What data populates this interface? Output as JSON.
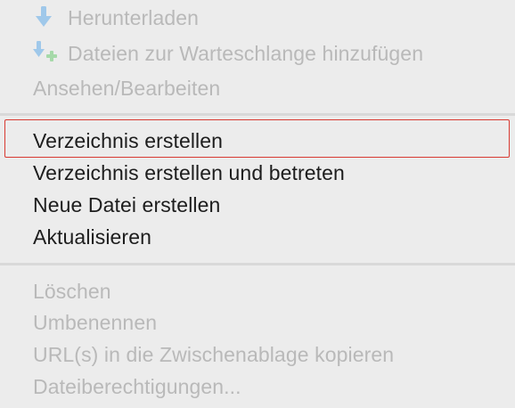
{
  "context_menu": {
    "items_top": [
      {
        "label": "Herunterladen",
        "icon": "download-arrow-icon",
        "enabled": false
      },
      {
        "label": "Dateien zur Warteschlange hinzufügen",
        "icon": "add-to-queue-icon",
        "enabled": false
      },
      {
        "label": "Ansehen/Bearbeiten",
        "enabled": false
      }
    ],
    "items_middle": [
      {
        "label": "Verzeichnis erstellen",
        "enabled": true,
        "highlighted": true
      },
      {
        "label": "Verzeichnis erstellen und betreten",
        "enabled": true
      },
      {
        "label": "Neue Datei erstellen",
        "enabled": true
      },
      {
        "label": "Aktualisieren",
        "enabled": true
      }
    ],
    "items_bottom": [
      {
        "label": "Löschen",
        "enabled": false
      },
      {
        "label": "Umbenennen",
        "enabled": false
      },
      {
        "label": "URL(s) in die Zwischenablage kopieren",
        "enabled": false
      },
      {
        "label": "Dateiberechtigungen...",
        "enabled": false
      }
    ]
  },
  "colors": {
    "background": "#ececec",
    "enabled_text": "#1d1d1d",
    "disabled_text": "#b9b9b9",
    "separator": "#d9d9d9",
    "highlight_border": "#d83a32",
    "icon_blue": "#5aa9e6",
    "icon_green": "#6cc070"
  }
}
